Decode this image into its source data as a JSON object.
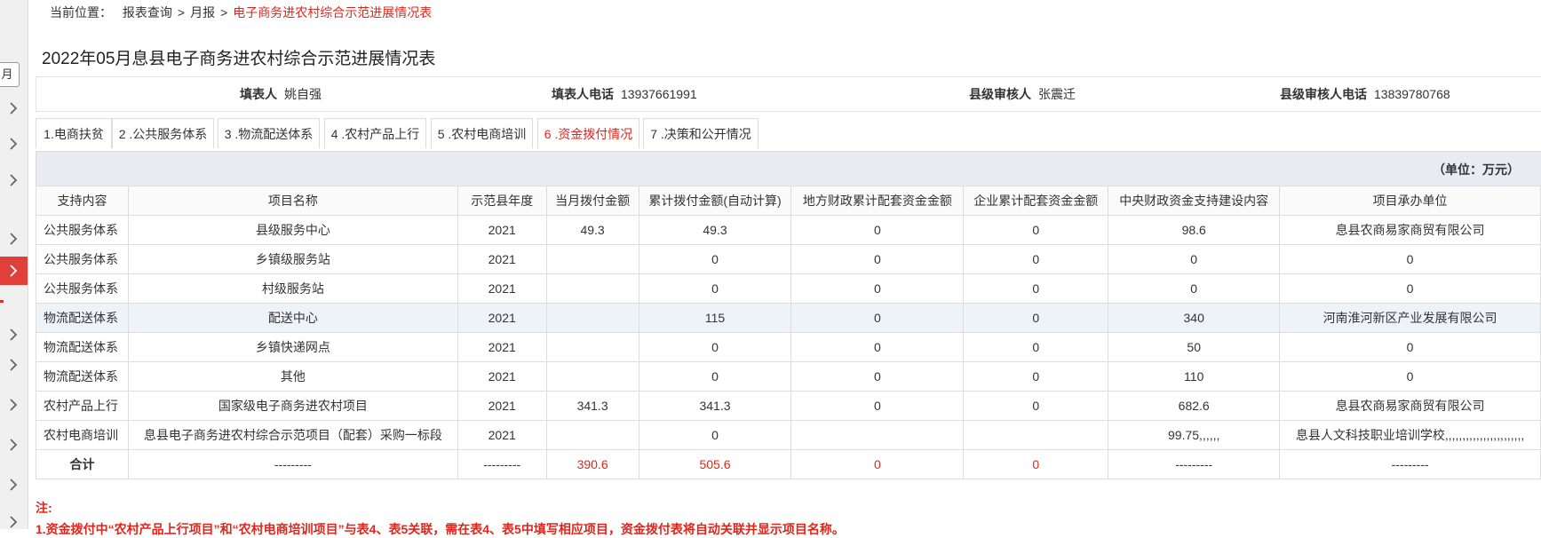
{
  "breadcrumb": {
    "prefix": "当前位置：",
    "items": [
      "报表查询",
      "月报"
    ],
    "current": "电子商务进农村综合示范进展情况表",
    "separator": ">"
  },
  "sidebar": {
    "box_label": "月"
  },
  "page_title": "2022年05月息县电子商务进农村综合示范进展情况表",
  "info": {
    "filler_label": "填表人",
    "filler": "姚自强",
    "phone_label": "填表人电话",
    "phone": "13937661991",
    "reviewer_label": "县级审核人",
    "reviewer": "张震迁",
    "reviewer_phone_label": "县级审核人电话",
    "reviewer_phone": "13839780768"
  },
  "tabs": [
    {
      "label": "1.电商扶贫"
    },
    {
      "label": "2 .公共服务体系"
    },
    {
      "label": "3 .物流配送体系"
    },
    {
      "label": "4 .农村产品上行"
    },
    {
      "label": "5 .农村电商培训"
    },
    {
      "label": "6 .资金拨付情况",
      "active": true
    },
    {
      "label": "7 .决策和公开情况"
    }
  ],
  "unit_label": "（单位：万元）",
  "table": {
    "headers": [
      "支持内容",
      "项目名称",
      "示范县年度",
      "当月拨付金额",
      "累计拨付金额(自动计算)",
      "地方财政累计配套资金金额",
      "企业累计配套资金金额",
      "中央财政资金支持建设内容",
      "项目承办单位"
    ],
    "rows": [
      [
        "公共服务体系",
        "县级服务中心",
        "2021",
        "49.3",
        "49.3",
        "0",
        "0",
        "98.6",
        "息县农商易家商贸有限公司"
      ],
      [
        "公共服务体系",
        "乡镇级服务站",
        "2021",
        "",
        "0",
        "0",
        "0",
        "0",
        "0"
      ],
      [
        "公共服务体系",
        "村级服务站",
        "2021",
        "",
        "0",
        "0",
        "0",
        "0",
        "0"
      ],
      [
        "物流配送体系",
        "配送中心",
        "2021",
        "",
        "115",
        "0",
        "0",
        "340",
        "河南淮河新区产业发展有限公司"
      ],
      [
        "物流配送体系",
        "乡镇快递网点",
        "2021",
        "",
        "0",
        "0",
        "0",
        "50",
        "0"
      ],
      [
        "物流配送体系",
        "其他",
        "2021",
        "",
        "0",
        "0",
        "0",
        "110",
        "0"
      ],
      [
        "农村产品上行",
        "国家级电子商务进农村项目",
        "2021",
        "341.3",
        "341.3",
        "0",
        "0",
        "682.6",
        "息县农商易家商贸有限公司"
      ],
      [
        "农村电商培训",
        "息县电子商务进农村综合示范项目（配套）采购一标段",
        "2021",
        "",
        "0",
        "",
        "",
        "99.75,,,,,,",
        "息县人文科技职业培训学校,,,,,,,,,,,,,,,,,,,,,,,"
      ]
    ],
    "total": [
      "合计",
      "---------",
      "---------",
      "390.6",
      "505.6",
      "0",
      "0",
      "---------",
      "---------"
    ]
  },
  "notes": {
    "heading": "注:",
    "line1": "1.资金拨付中“农村产品上行项目”和“农村电商培训项目”与表4、表5关联，需在表4、表5中填写相应项目，资金拨付表将自动关联并显示项目名称。"
  },
  "colors": {
    "accent_red": "#e0261c",
    "active_sidebar": "#e0403a",
    "header_bg": "#e8ecf2"
  }
}
